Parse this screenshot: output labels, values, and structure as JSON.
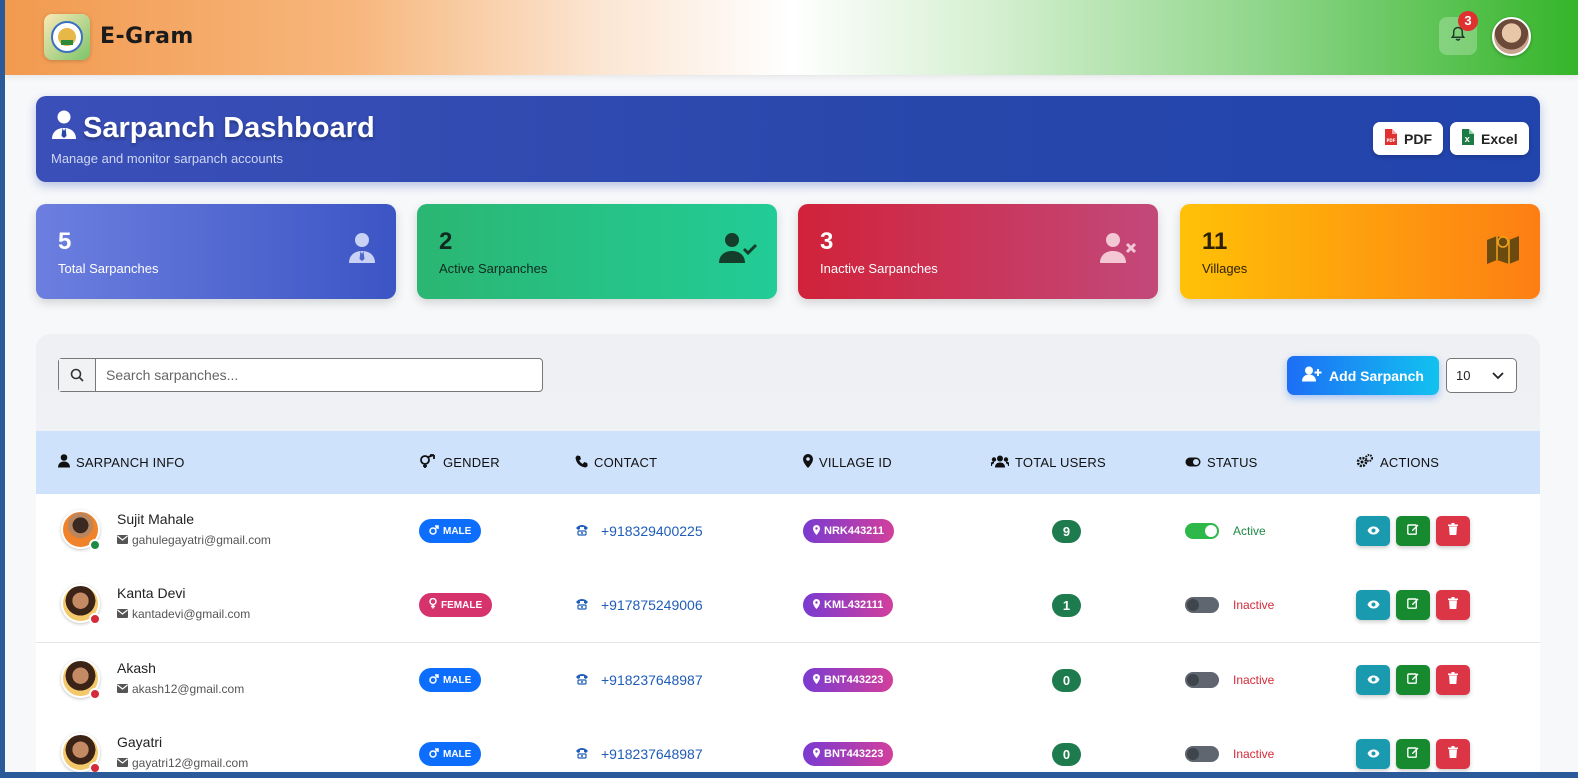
{
  "app": {
    "brand": "E-Gram",
    "notification_count": "3"
  },
  "header": {
    "title": "Sarpanch Dashboard",
    "subtitle": "Manage and monitor sarpanch accounts",
    "pdf_label": "PDF",
    "excel_label": "Excel"
  },
  "stats": [
    {
      "value": "5",
      "label": "Total Sarpanches",
      "icon": "user-tie-icon"
    },
    {
      "value": "2",
      "label": "Active Sarpanches",
      "icon": "user-check-icon"
    },
    {
      "value": "3",
      "label": "Inactive Sarpanches",
      "icon": "user-times-icon"
    },
    {
      "value": "11",
      "label": "Villages",
      "icon": "map-icon"
    }
  ],
  "toolbar": {
    "search_placeholder": "Search sarpanches...",
    "add_label": "Add Sarpanch",
    "page_size": "10"
  },
  "table": {
    "headers": [
      "SARPANCH INFO",
      "GENDER",
      "CONTACT",
      "VILLAGE ID",
      "TOTAL USERS",
      "STATUS",
      "ACTIONS"
    ],
    "rows": [
      {
        "name": "Sujit Mahale",
        "email": "gahulegayatri@gmail.com",
        "gender": "MALE",
        "phone": "+918329400225",
        "village": "NRK443211",
        "users": "9",
        "status": "Active"
      },
      {
        "name": "Kanta Devi",
        "email": "kantadevi@gmail.com",
        "gender": "FEMALE",
        "phone": "+917875249006",
        "village": "KML432111",
        "users": "1",
        "status": "Inactive"
      },
      {
        "name": "Akash",
        "email": "akash12@gmail.com",
        "gender": "MALE",
        "phone": "+918237648987",
        "village": "BNT443223",
        "users": "0",
        "status": "Inactive"
      },
      {
        "name": "Gayatri",
        "email": "gayatri12@gmail.com",
        "gender": "MALE",
        "phone": "+918237648987",
        "village": "BNT443223",
        "users": "0",
        "status": "Inactive"
      }
    ]
  },
  "colors": {
    "male": "#0d6efd",
    "female": "#d6336c",
    "active": "#1e8a45",
    "inactive": "#d42a3a",
    "view": "#1a9aaf",
    "edit": "#178a2f",
    "delete": "#dc3545"
  }
}
